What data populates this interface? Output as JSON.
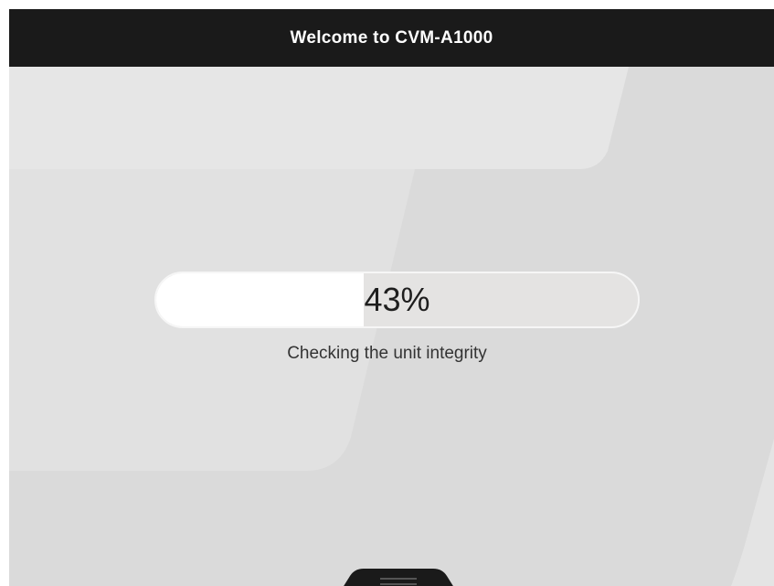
{
  "header": {
    "title": "Welcome to CVM-A1000"
  },
  "progress": {
    "percent_label": "43%",
    "value_percent": 43,
    "status": "Checking the unit integrity"
  },
  "colors": {
    "header_bg": "#1a1a1a",
    "screen_bg": "#dadada",
    "track_bg": "#e4e3e2",
    "fill": "#ffffff"
  },
  "icons": {
    "home_tab": "home-handle-icon"
  }
}
